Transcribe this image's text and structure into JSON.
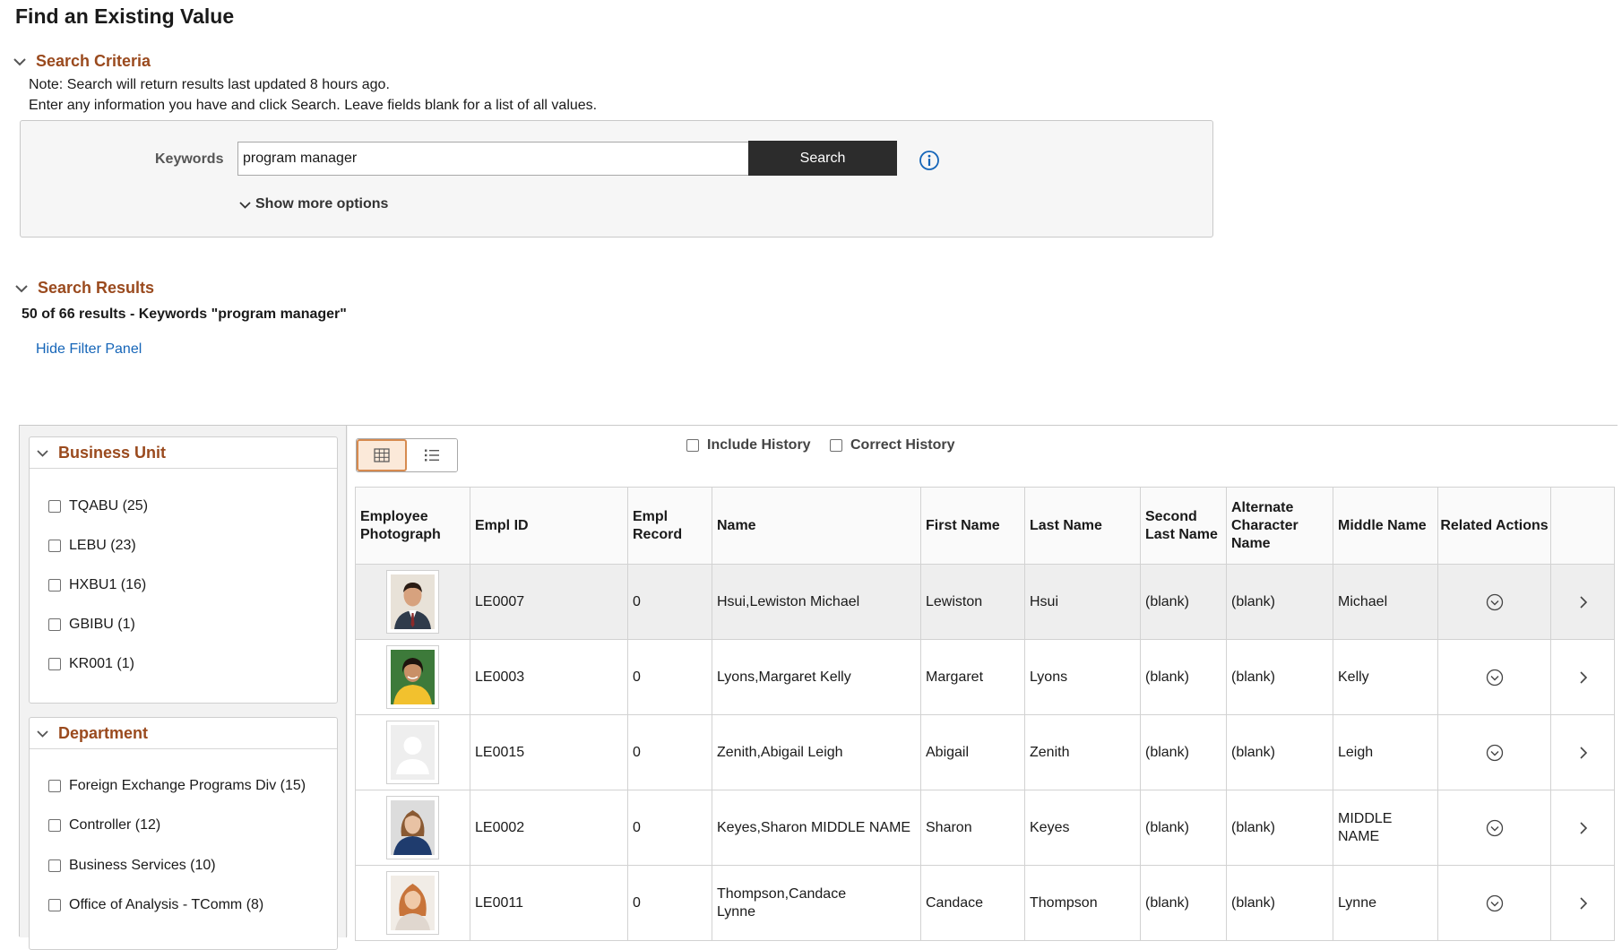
{
  "page": {
    "title": "Find an Existing Value"
  },
  "search_criteria": {
    "header": "Search Criteria",
    "note": "Note: Search will return results last updated 8 hours ago.",
    "instructions": "Enter any information you have and click Search. Leave fields blank for a list of all values.",
    "keywords_label": "Keywords",
    "keywords_value": "program manager",
    "search_button": "Search",
    "show_more": "Show more options"
  },
  "search_results": {
    "header": "Search Results",
    "summary": "50 of 66 results - Keywords \"program manager\"",
    "hide_filter": "Hide Filter Panel"
  },
  "filters": [
    {
      "title": "Business Unit",
      "items": [
        "TQABU (25)",
        "LEBU (23)",
        "HXBU1 (16)",
        "GBIBU (1)",
        "KR001 (1)"
      ]
    },
    {
      "title": "Department",
      "items": [
        "Foreign Exchange Programs Div (15)",
        "Controller (12)",
        "Business Services (10)",
        "Office of Analysis - TComm (8)"
      ]
    }
  ],
  "options": {
    "include_history": "Include History",
    "correct_history": "Correct History"
  },
  "grid": {
    "columns": [
      "Employee Photograph",
      "Empl ID",
      "Empl Record",
      "Name",
      "First Name",
      "Last Name",
      "Second Last Name",
      "Alternate Character Name",
      "Middle Name",
      "Related Actions"
    ],
    "rows": [
      {
        "photo": "photo-man-suit",
        "empl_id": "LE0007",
        "empl_record": "0",
        "name": "Hsui,Lewiston Michael",
        "first_name": "Lewiston",
        "last_name": "Hsui",
        "second_last_name": "(blank)",
        "alt_char_name": "(blank)",
        "middle_name": "Michael"
      },
      {
        "photo": "photo-woman-yellow",
        "empl_id": "LE0003",
        "empl_record": "0",
        "name": "Lyons,Margaret Kelly",
        "first_name": "Margaret",
        "last_name": "Lyons",
        "second_last_name": "(blank)",
        "alt_char_name": "(blank)",
        "middle_name": "Kelly"
      },
      {
        "photo": "photo-placeholder",
        "empl_id": "LE0015",
        "empl_record": "0",
        "name": "Zenith,Abigail Leigh",
        "first_name": "Abigail",
        "last_name": "Zenith",
        "second_last_name": "(blank)",
        "alt_char_name": "(blank)",
        "middle_name": "Leigh"
      },
      {
        "photo": "photo-woman-navy",
        "empl_id": "LE0002",
        "empl_record": "0",
        "name": "Keyes,Sharon MIDDLE NAME",
        "first_name": "Sharon",
        "last_name": "Keyes",
        "second_last_name": "(blank)",
        "alt_char_name": "(blank)",
        "middle_name": "MIDDLE NAME"
      },
      {
        "photo": "photo-woman-redhead",
        "empl_id": "LE0011",
        "empl_record": "0",
        "name": "Thompson,Candace Lynne",
        "first_name": "Candace",
        "last_name": "Thompson",
        "second_last_name": "(blank)",
        "alt_char_name": "(blank)",
        "middle_name": "Lynne"
      }
    ]
  },
  "colors": {
    "section_header": "#9a4a1e",
    "link": "#1565b8",
    "search_button_bg": "#2c2c2c",
    "info_icon": "#1565b8"
  }
}
